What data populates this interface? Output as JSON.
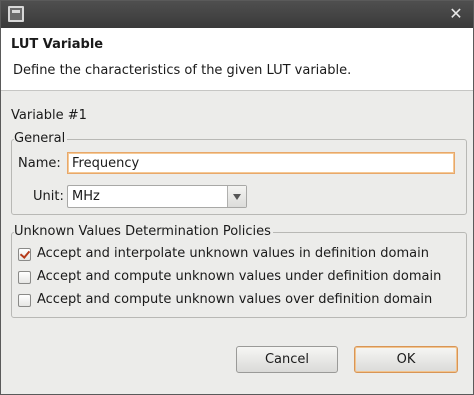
{
  "window": {
    "close_glyph": "✕"
  },
  "banner": {
    "title": "LUT Variable",
    "description": "Define the characteristics of the given LUT variable."
  },
  "variable": {
    "label": "Variable #1"
  },
  "general": {
    "legend": "General",
    "name_label": "Name:",
    "name_value": "Frequency",
    "unit_label": "Unit:",
    "unit_value": "MHz"
  },
  "policies": {
    "legend": "Unknown Values Determination Policies",
    "options": [
      {
        "label": "Accept and interpolate unknown values in definition domain",
        "checked": true
      },
      {
        "label": "Accept and compute unknown values under definition domain",
        "checked": false
      },
      {
        "label": "Accept and compute unknown values over definition domain",
        "checked": false
      }
    ]
  },
  "buttons": {
    "cancel": "Cancel",
    "ok": "OK"
  }
}
